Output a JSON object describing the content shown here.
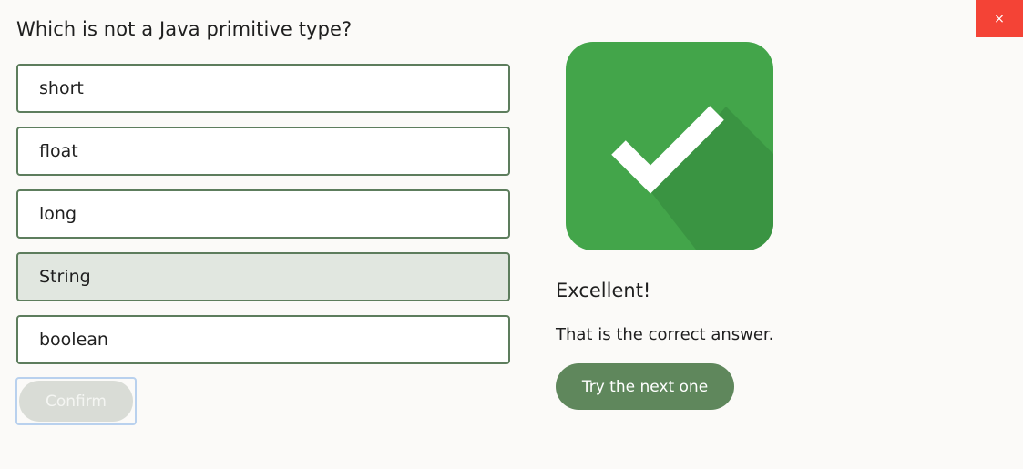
{
  "question": "Which is not a Java primitive type?",
  "options": [
    {
      "label": "short",
      "selected": false
    },
    {
      "label": "float",
      "selected": false
    },
    {
      "label": "long",
      "selected": false
    },
    {
      "label": "String",
      "selected": true
    },
    {
      "label": "boolean",
      "selected": false
    }
  ],
  "confirm_label": "Confirm",
  "close_label": "×",
  "result": {
    "title": "Excellent!",
    "message": "That is the correct answer.",
    "next_label": "Try the next one",
    "icon": "checkmark-icon"
  },
  "colors": {
    "option_border": "#5d7d5d",
    "selected_bg": "#e1e7e0",
    "close_bg": "#f44336",
    "icon_green": "#43a54a",
    "next_button_bg": "#5f875c"
  }
}
